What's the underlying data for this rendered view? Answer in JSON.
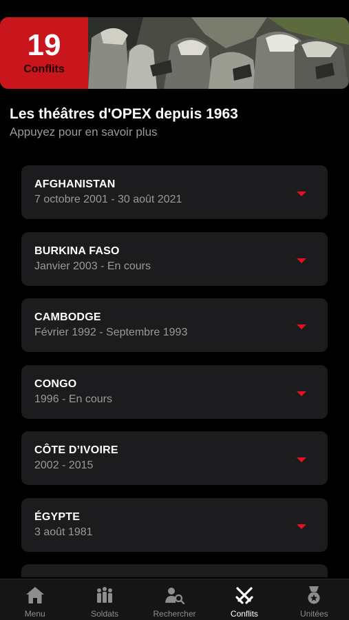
{
  "banner": {
    "count": "19",
    "count_label": "Conflits"
  },
  "heading": {
    "title": "Les théâtres d'OPEX depuis 1963",
    "subtitle": "Appuyez pour en savoir plus"
  },
  "conflicts": [
    {
      "name": "AFGHANISTAN",
      "dates": "7 octobre 2001 - 30 août 2021"
    },
    {
      "name": "BURKINA FASO",
      "dates": "Janvier 2003 - En cours"
    },
    {
      "name": "CAMBODGE",
      "dates": "Février 1992 - Septembre 1993"
    },
    {
      "name": "CONGO",
      "dates": "1996 - En cours"
    },
    {
      "name": "CÔTE D’IVOIRE",
      "dates": "2002 - 2015"
    },
    {
      "name": "ÉGYPTE",
      "dates": "3 août 1981"
    }
  ],
  "tabs": [
    {
      "label": "Menu",
      "icon": "home-icon"
    },
    {
      "label": "Soldats",
      "icon": "soldiers-icon"
    },
    {
      "label": "Rechercher",
      "icon": "search-person-icon"
    },
    {
      "label": "Conflits",
      "icon": "crossed-swords-icon"
    },
    {
      "label": "Unitées",
      "icon": "medal-icon"
    }
  ],
  "colors": {
    "accent": "#c8161c",
    "caret": "#e0141c",
    "card": "#1c1c1e",
    "background": "#000000"
  }
}
